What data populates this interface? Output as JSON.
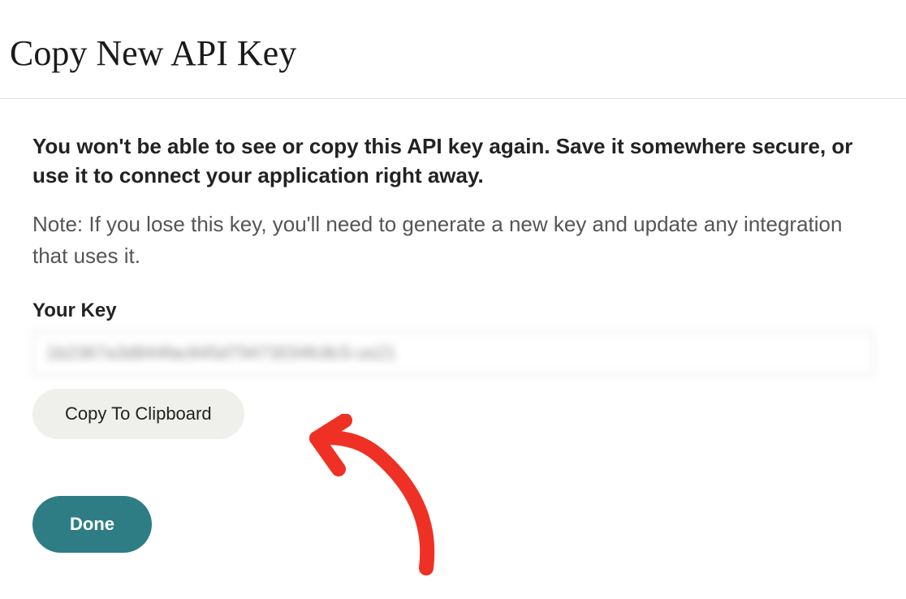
{
  "header": {
    "title": "Copy New API Key"
  },
  "body": {
    "warning": "You won't be able to see or copy this API key again. Save it somewhere secure, or use it to connect your application right away.",
    "note": "Note: If you lose this key, you'll need to generate a new key and update any integration that uses it.",
    "key_label": "Your Key",
    "key_value": "1b2367a3d844fac845d79473034fc8c5-us21",
    "copy_button_label": "Copy To Clipboard",
    "done_button_label": "Done"
  }
}
